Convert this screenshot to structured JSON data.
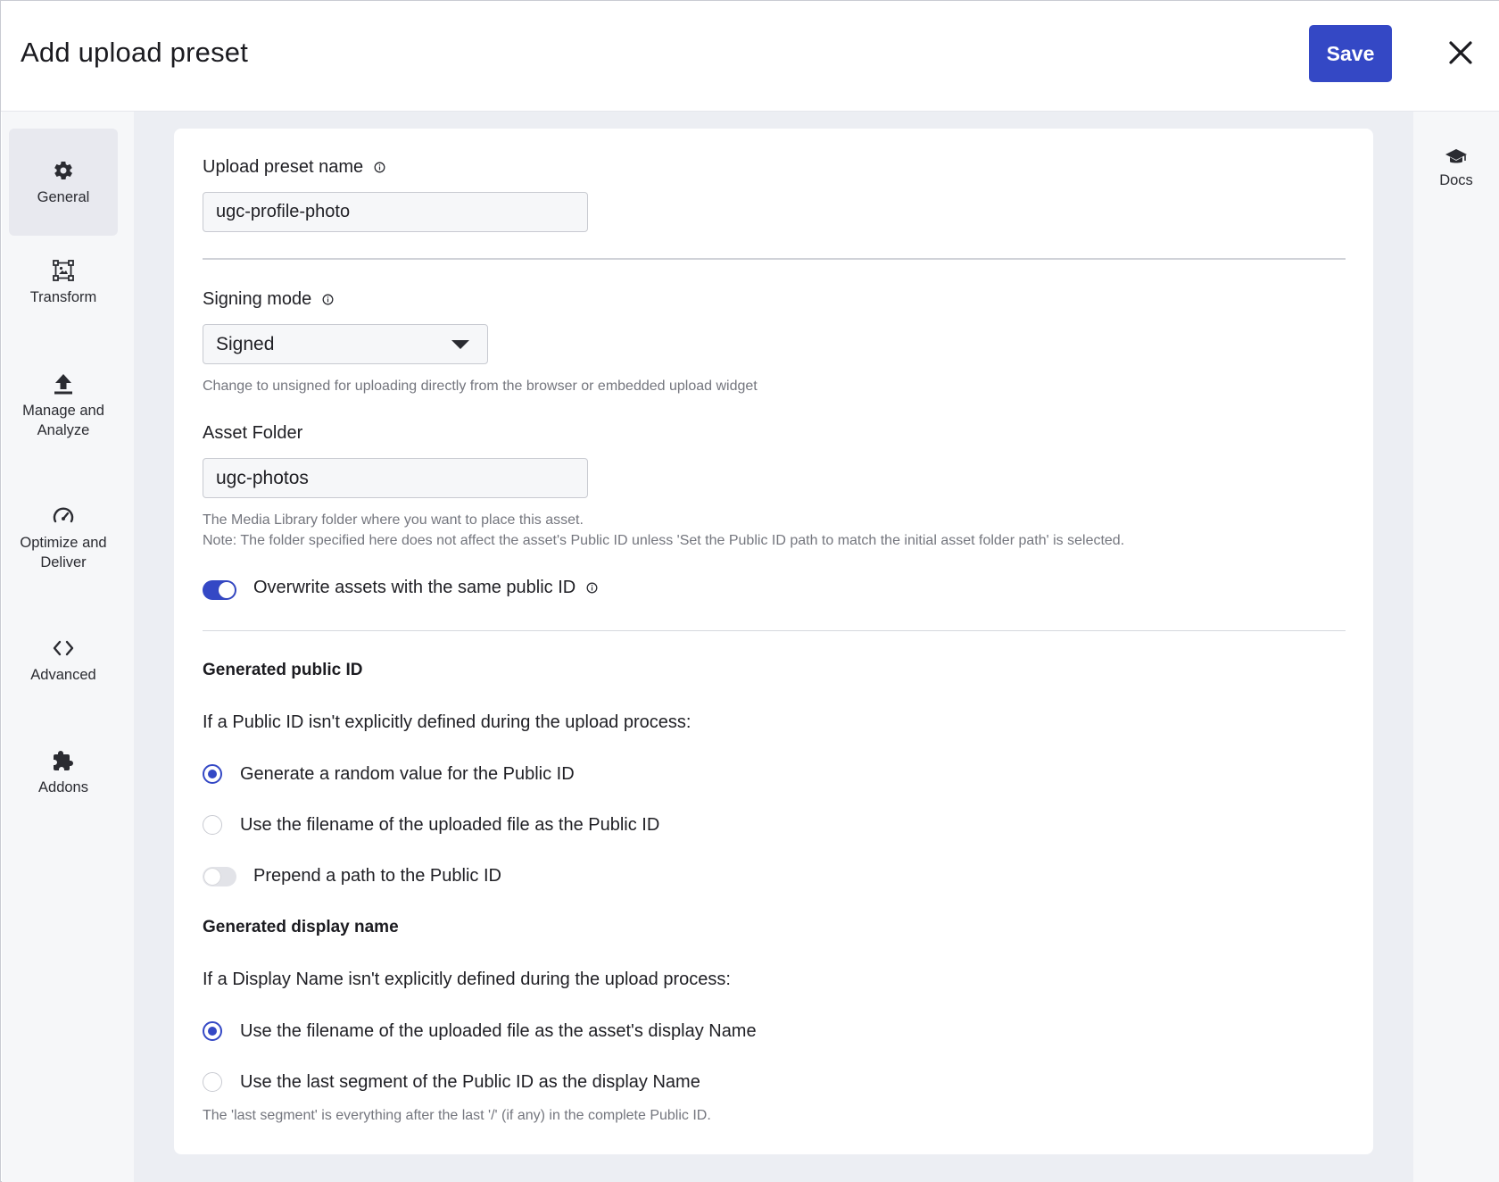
{
  "header": {
    "title": "Add upload preset",
    "save_label": "Save"
  },
  "left_nav": {
    "items": [
      {
        "label": "General",
        "icon": "gear-icon",
        "active": true
      },
      {
        "label": "Transform",
        "icon": "transform-icon",
        "active": false
      },
      {
        "label": "Manage and Analyze",
        "icon": "upload-icon",
        "active": false
      },
      {
        "label": "Optimize and Deliver",
        "icon": "gauge-icon",
        "active": false
      },
      {
        "label": "Advanced",
        "icon": "code-icon",
        "active": false
      },
      {
        "label": "Addons",
        "icon": "puzzle-icon",
        "active": false
      }
    ]
  },
  "right_nav": {
    "docs_label": "Docs"
  },
  "form": {
    "preset_name_label": "Upload preset name",
    "preset_name_value": "ugc-profile-photo",
    "signing_mode_label": "Signing mode",
    "signing_mode_value": "Signed",
    "signing_mode_hint": "Change to unsigned for uploading directly from the browser or embedded upload widget",
    "asset_folder_label": "Asset Folder",
    "asset_folder_value": "ugc-photos",
    "asset_folder_hint_1": "The Media Library folder where you want to place this asset.",
    "asset_folder_hint_2": "Note: The folder specified here does not affect the asset's Public ID unless 'Set the Public ID path to match the initial asset folder path' is selected.",
    "overwrite_label": "Overwrite assets with the same public ID",
    "overwrite_on": true,
    "public_id": {
      "title": "Generated public ID",
      "intro": "If a Public ID isn't explicitly defined during the upload process:",
      "option_random": "Generate a random value for the Public ID",
      "option_filename": "Use the filename of the uploaded file as the Public ID",
      "selected": "random",
      "prepend_label": "Prepend a path to the Public ID",
      "prepend_on": false
    },
    "display_name": {
      "title": "Generated display name",
      "intro": "If a Display Name isn't explicitly defined during the upload process:",
      "option_filename": "Use the filename of the uploaded file as the asset's display Name",
      "option_last_segment": "Use the last segment of the Public ID as the display Name",
      "selected": "filename",
      "hint": "The 'last segment' is everything after the last '/' (if any) in the complete Public ID."
    }
  },
  "colors": {
    "accent": "#3448c5",
    "background": "#eceef3",
    "nav_background": "#f6f7f9",
    "hint_text": "#74767e"
  }
}
